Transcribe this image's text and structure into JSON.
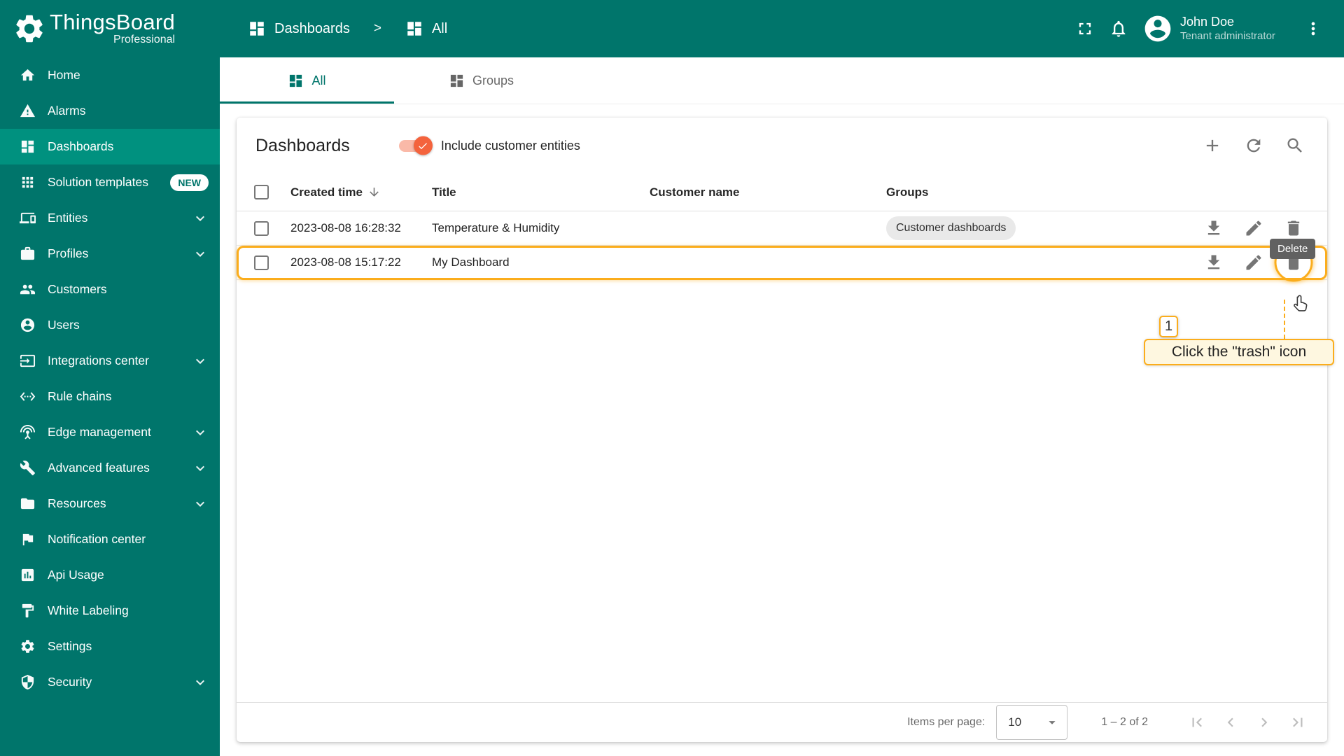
{
  "theme": {
    "primary": "#00756B",
    "accent_orange": "#F4633D",
    "annotation_amber": "#FBAD1C"
  },
  "app": {
    "name": "ThingsBoard",
    "edition": "Professional"
  },
  "header": {
    "breadcrumb": [
      {
        "label": "Dashboards",
        "icon": "dashboard-grid"
      },
      {
        "label": "All",
        "icon": "dashboard-grid"
      }
    ],
    "breadcrumb_separator": ">",
    "user": {
      "name": "John Doe",
      "role": "Tenant administrator"
    }
  },
  "sidebar": {
    "items": [
      {
        "label": "Home",
        "icon": "home"
      },
      {
        "label": "Alarms",
        "icon": "warning"
      },
      {
        "label": "Dashboards",
        "icon": "dashboard-grid",
        "active": true
      },
      {
        "label": "Solution templates",
        "icon": "apps",
        "badge": "NEW"
      },
      {
        "label": "Entities",
        "icon": "devices",
        "expandable": true
      },
      {
        "label": "Profiles",
        "icon": "work",
        "expandable": true
      },
      {
        "label": "Customers",
        "icon": "people"
      },
      {
        "label": "Users",
        "icon": "person-circle"
      },
      {
        "label": "Integrations center",
        "icon": "input",
        "expandable": true
      },
      {
        "label": "Rule chains",
        "icon": "ethernet"
      },
      {
        "label": "Edge management",
        "icon": "antenna",
        "expandable": true
      },
      {
        "label": "Advanced features",
        "icon": "build",
        "expandable": true
      },
      {
        "label": "Resources",
        "icon": "folder",
        "expandable": true
      },
      {
        "label": "Notification center",
        "icon": "flag"
      },
      {
        "label": "Api Usage",
        "icon": "chart"
      },
      {
        "label": "White Labeling",
        "icon": "paint"
      },
      {
        "label": "Settings",
        "icon": "settings"
      },
      {
        "label": "Security",
        "icon": "security",
        "expandable": true
      }
    ]
  },
  "tabs": [
    {
      "label": "All",
      "icon": "dashboard-grid",
      "active": true
    },
    {
      "label": "Groups",
      "icon": "dashboard-grid",
      "active": false
    }
  ],
  "main": {
    "title": "Dashboards",
    "toggle": {
      "label": "Include customer entities",
      "checked": true
    },
    "table": {
      "columns": [
        {
          "label": "Created time",
          "sort": "desc"
        },
        {
          "label": "Title"
        },
        {
          "label": "Customer name"
        },
        {
          "label": "Groups"
        }
      ],
      "rows": [
        {
          "created_time": "2023-08-08 16:28:32",
          "title": "Temperature & Humidity",
          "customer_name": "",
          "groups": [
            "Customer dashboards"
          ]
        },
        {
          "created_time": "2023-08-08 15:17:22",
          "title": "My Dashboard",
          "customer_name": "",
          "groups": []
        }
      ]
    },
    "pagination": {
      "items_per_page_label": "Items per page:",
      "items_per_page": "10",
      "range": "1 – 2 of 2"
    }
  },
  "icons": {
    "card_actions": [
      "add",
      "refresh",
      "search"
    ],
    "row_actions": [
      "download",
      "edit",
      "delete"
    ],
    "paginator": [
      "first-page",
      "chevron-left",
      "chevron-right",
      "last-page"
    ]
  },
  "tooltip": {
    "text": "Delete"
  },
  "annotation": {
    "step": "1",
    "text": "Click the \"trash\" icon",
    "highlight_row_index": 1,
    "target_action": "delete"
  }
}
